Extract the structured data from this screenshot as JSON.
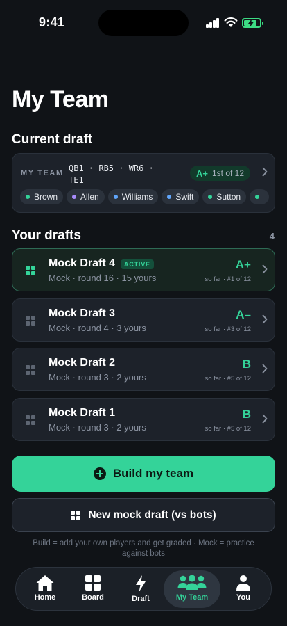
{
  "status_bar": {
    "time": "9:41"
  },
  "page": {
    "title": "My Team"
  },
  "current_draft": {
    "heading": "Current draft",
    "label": "MY TEAM",
    "positions": "QB1 · RB5 · WR6 · TE1",
    "grade": "A+",
    "rank": "1st of 12",
    "players": [
      {
        "name": "Brown",
        "color": "#34d399"
      },
      {
        "name": "Allen",
        "color": "#a78bfa"
      },
      {
        "name": "Williams",
        "color": "#60a5fa"
      },
      {
        "name": "Swift",
        "color": "#60a5fa"
      },
      {
        "name": "Sutton",
        "color": "#34d399"
      },
      {
        "name": "",
        "color": "#34d399"
      }
    ]
  },
  "your_drafts": {
    "heading": "Your drafts",
    "count": "4",
    "items": [
      {
        "name": "Mock Draft 4",
        "badge": "ACTIVE",
        "sub": "Mock · round 16 · 15 yours",
        "grade": "A+",
        "sofar": "so far · #1 of 12",
        "active": true
      },
      {
        "name": "Mock Draft 3",
        "badge": "",
        "sub": "Mock · round 4 · 3 yours",
        "grade": "A–",
        "sofar": "so far · #3 of 12",
        "active": false
      },
      {
        "name": "Mock Draft 2",
        "badge": "",
        "sub": "Mock · round 3 · 2 yours",
        "grade": "B",
        "sofar": "so far · #5 of 12",
        "active": false
      },
      {
        "name": "Mock Draft 1",
        "badge": "",
        "sub": "Mock · round 3 · 2 yours",
        "grade": "B",
        "sofar": "so far · #5 of 12",
        "active": false
      }
    ]
  },
  "actions": {
    "build_label": "Build my team",
    "mock_label": "New mock draft (vs bots)",
    "footnote": "Build = add your own players and get graded · Mock = practice against bots"
  },
  "tabs": [
    {
      "label": "Home",
      "icon": "home-icon",
      "selected": false
    },
    {
      "label": "Board",
      "icon": "grid-icon",
      "selected": false
    },
    {
      "label": "Draft",
      "icon": "bolt-icon",
      "selected": false
    },
    {
      "label": "My Team",
      "icon": "team-icon",
      "selected": true
    },
    {
      "label": "You",
      "icon": "person-icon",
      "selected": false
    }
  ],
  "colors": {
    "accent": "#34d399",
    "background": "#101317",
    "card": "#1d222a"
  }
}
